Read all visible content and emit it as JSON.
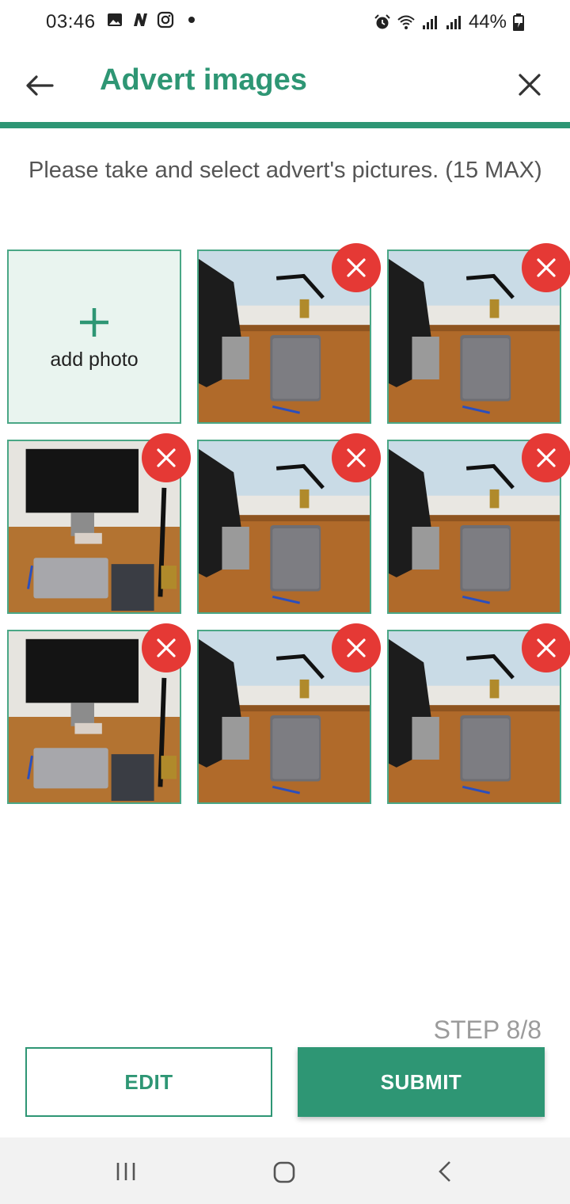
{
  "status": {
    "time": "03:46",
    "battery": "44%",
    "icons": [
      "gallery-icon",
      "n-app-icon",
      "instagram-icon",
      "notification-dot",
      "alarm-icon",
      "wifi-icon",
      "signal-icon",
      "signal-icon",
      "battery-charging-icon"
    ]
  },
  "appbar": {
    "title": "Advert images",
    "back_icon": "arrow-left-icon",
    "close_icon": "close-icon"
  },
  "instruction": "Please take and select advert's pictures. (15 MAX)",
  "grid": {
    "add_label": "add photo",
    "add_icon": "plus-icon",
    "photo_count": 8
  },
  "footer": {
    "step": "STEP 8/8",
    "edit_label": "EDIT",
    "submit_label": "SUBMIT"
  },
  "navbar": {
    "icons": [
      "recent-apps-icon",
      "home-icon",
      "back-nav-icon"
    ]
  },
  "colors": {
    "accent": "#2e9674",
    "delete": "#e53935"
  }
}
